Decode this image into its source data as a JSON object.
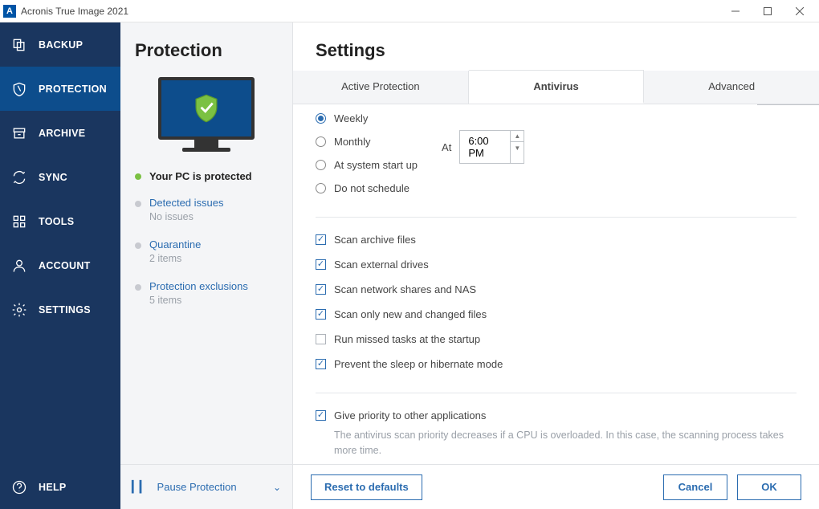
{
  "window": {
    "title": "Acronis True Image 2021",
    "logo": "A"
  },
  "nav": {
    "items": [
      {
        "label": "BACKUP"
      },
      {
        "label": "PROTECTION"
      },
      {
        "label": "ARCHIVE"
      },
      {
        "label": "SYNC"
      },
      {
        "label": "TOOLS"
      },
      {
        "label": "ACCOUNT"
      },
      {
        "label": "SETTINGS"
      }
    ],
    "help": "HELP"
  },
  "side": {
    "title": "Protection",
    "status": "Your PC is protected",
    "blocks": [
      {
        "title": "Detected issues",
        "sub": "No issues"
      },
      {
        "title": "Quarantine",
        "sub": "2 items"
      },
      {
        "title": "Protection exclusions",
        "sub": "5 items"
      }
    ],
    "pause": "Pause Protection"
  },
  "settings": {
    "title": "Settings",
    "tabs": [
      {
        "label": "Active Protection"
      },
      {
        "label": "Antivirus"
      },
      {
        "label": "Advanced"
      }
    ],
    "schedule": {
      "options": [
        {
          "label": "Weekly",
          "checked": true
        },
        {
          "label": "Monthly",
          "checked": false
        },
        {
          "label": "At system start up",
          "checked": false
        },
        {
          "label": "Do not schedule",
          "checked": false
        }
      ],
      "at_label": "At",
      "time": "6:00 PM"
    },
    "checks1": [
      {
        "label": "Scan archive files",
        "checked": true
      },
      {
        "label": "Scan external drives",
        "checked": true
      },
      {
        "label": "Scan network shares and NAS",
        "checked": true
      },
      {
        "label": "Scan only new and changed files",
        "checked": true
      },
      {
        "label": "Run missed tasks at the startup",
        "checked": false
      },
      {
        "label": "Prevent the sleep or hibernate mode",
        "checked": true
      }
    ],
    "checks2": [
      {
        "label": "Give priority to other applications",
        "checked": true,
        "desc": "The antivirus scan priority decreases if a CPU is overloaded. In this case, the scanning process takes more time."
      }
    ],
    "footer": {
      "reset": "Reset to defaults",
      "cancel": "Cancel",
      "ok": "OK"
    }
  }
}
